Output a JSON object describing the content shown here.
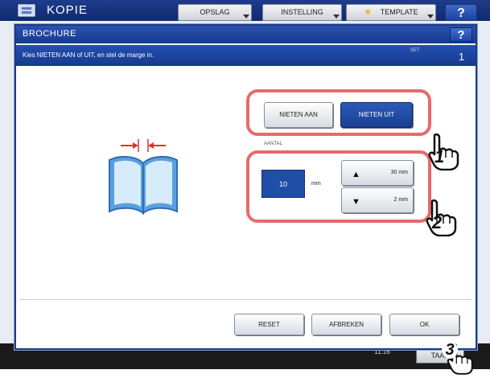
{
  "background_screen": {
    "title": "KOPIE",
    "tabs": [
      "OPSLAG",
      "INSTELLING",
      "TEMPLATE"
    ],
    "help_label": "?",
    "taak_label": "TAAK",
    "clock": "11:16"
  },
  "dialog": {
    "title": "BROCHURE",
    "help_label": "?",
    "message": "Kies NIETEN AAN of UIT, en stel de marge in.",
    "set_label": "SET",
    "set_number": "1"
  },
  "staple": {
    "on_label": "NIETEN AAN",
    "off_label": "NIETEN UIT",
    "selected": "NIETEN UIT"
  },
  "margin": {
    "label": "AANTAL",
    "value": "10",
    "unit": "mm",
    "max_label": "30 mm",
    "min_label": "2 mm"
  },
  "footer": {
    "reset_label": "RESET",
    "cancel_label": "AFBREKEN",
    "ok_label": "OK"
  },
  "callouts": [
    "1",
    "2",
    "3"
  ],
  "colors": {
    "title_bar": "#1c3b86",
    "selected_button": "#1f4ea6",
    "highlight_frame": "#e86a6a",
    "book_blue": "#3b86d0",
    "arrow_red": "#e03030"
  },
  "icons": {
    "book": "book-icon",
    "up": "arrow-up-icon",
    "down": "arrow-down-icon",
    "hand": "hand-pointer-icon"
  }
}
